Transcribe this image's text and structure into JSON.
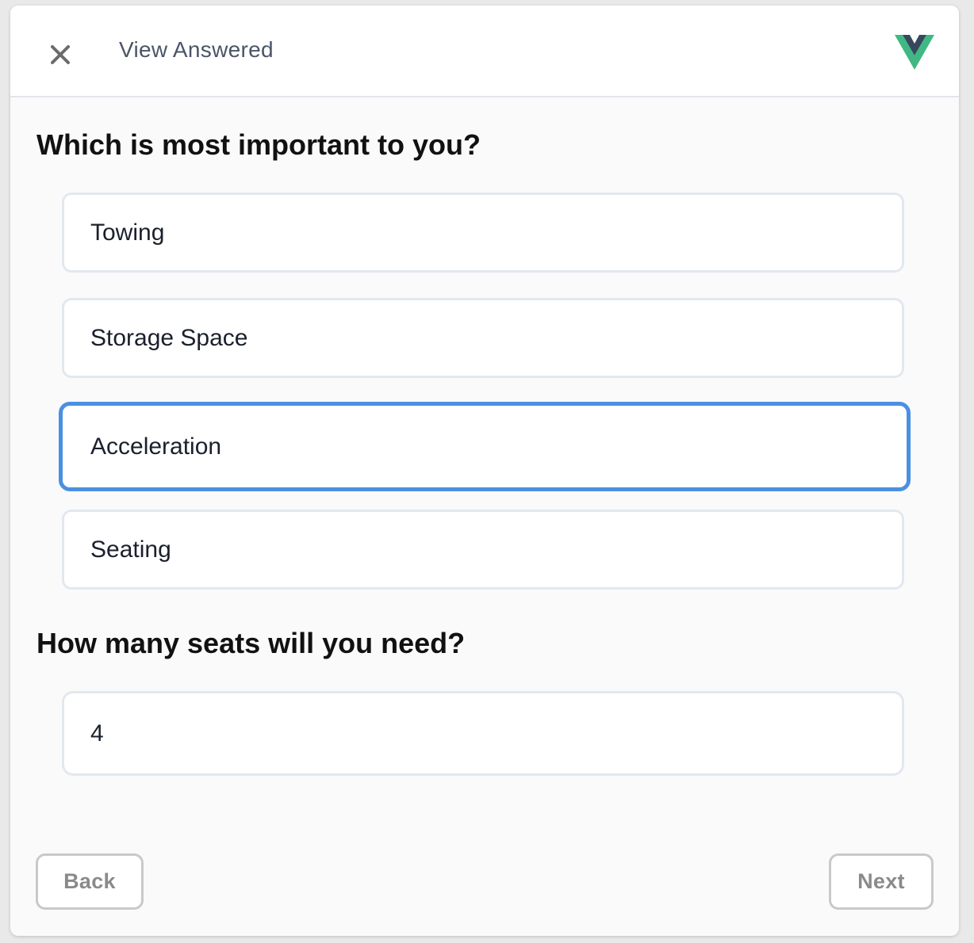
{
  "header": {
    "title": "View Answered",
    "close_icon": "close-icon",
    "logo_icon": "vue-logo-icon",
    "logo_colors": {
      "outer": "#41b883",
      "inner": "#35495e"
    }
  },
  "questions": [
    {
      "text": "Which is most important to you?",
      "options": [
        {
          "label": "Towing",
          "selected": false
        },
        {
          "label": "Storage Space",
          "selected": false
        },
        {
          "label": "Acceleration",
          "selected": true
        },
        {
          "label": "Seating",
          "selected": false
        }
      ]
    },
    {
      "text": "How many seats will you need?",
      "value": "4"
    }
  ],
  "footer": {
    "back_label": "Back",
    "next_label": "Next"
  },
  "colors": {
    "selected_border": "#4a90e2",
    "option_border": "#e2e8f0",
    "button_border": "#c9c9c9",
    "button_text": "#8a8a8a"
  }
}
